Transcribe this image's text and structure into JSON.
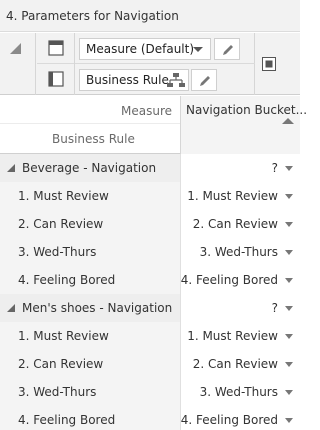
{
  "window": {
    "title": "4. Parameters for Navigation"
  },
  "toolbar": {
    "measure_chip": "Measure (Default)",
    "rule_chip": "Business Rule"
  },
  "grid": {
    "header": {
      "measure_label": "Measure",
      "business_rule_label": "Business Rule",
      "column_label": "Navigation Bucket..."
    },
    "groups": [
      {
        "label": "Beverage - Navigation",
        "value": "?",
        "rows": [
          {
            "label": "1. Must Review",
            "value": "1. Must Review"
          },
          {
            "label": "2. Can Review",
            "value": "2. Can Review"
          },
          {
            "label": "3. Wed-Thurs",
            "value": "3. Wed-Thurs"
          },
          {
            "label": "4. Feeling Bored",
            "value": "4. Feeling Bored"
          }
        ]
      },
      {
        "label": "Men's shoes - Navigation",
        "value": "?",
        "rows": [
          {
            "label": "1. Must Review",
            "value": "1. Must Review"
          },
          {
            "label": "2. Can Review",
            "value": "2. Can Review"
          },
          {
            "label": "3. Wed-Thurs",
            "value": "3. Wed-Thurs"
          },
          {
            "label": "4. Feeling Bored",
            "value": "4. Feeling Bored"
          }
        ]
      }
    ]
  }
}
